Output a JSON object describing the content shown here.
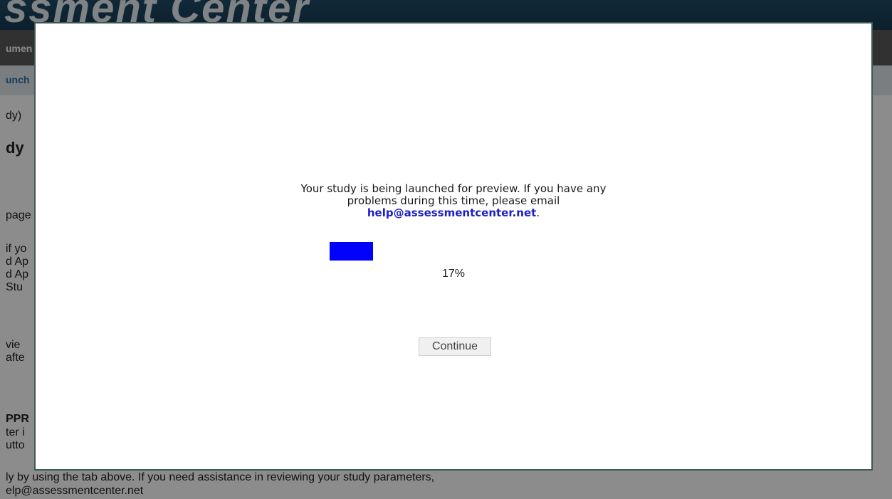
{
  "background": {
    "logo_text": "ssment Center",
    "nav_item": "umen",
    "sub_link": "unch",
    "lines": [
      "dy)",
      "dy",
      "page",
      "if yo",
      "d Ap",
      "d Ap",
      "Stu",
      "vie",
      "afte",
      "PPR",
      "ter i",
      "utto"
    ],
    "bottom_line_1": "ly by using the tab above. If you need assistance in reviewing your study parameters,",
    "bottom_line_2": "elp@assessmentcenter.net"
  },
  "modal": {
    "message_line_1": "Your study is being launched for preview. If you have any",
    "message_line_2": "problems during this time, please email",
    "email": "help@assessmentcenter.net",
    "email_suffix": ".",
    "progress_percent": 17,
    "progress_label": "17%",
    "continue_label": "Continue"
  },
  "colors": {
    "progress_fill": "#0000ff",
    "email_link": "#1c1cc9",
    "modal_border": "#3b5a55"
  }
}
